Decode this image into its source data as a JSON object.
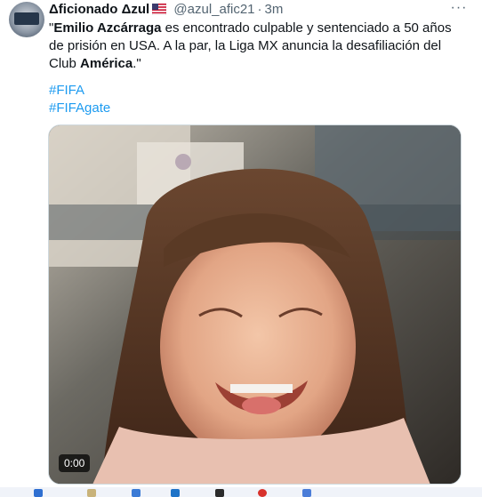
{
  "tweet": {
    "author_name": "Δficionado Δzul",
    "handle": "@azul_afic21",
    "separator": "·",
    "time": "3m",
    "more_label": "···",
    "text": {
      "part1": "\"",
      "bold1": "Emilio Azcárraga",
      "part2": " es encontrado culpable y sentenciado a 50 años de prisión en USA. A la par, la Liga MX anuncia la desafiliación del Club ",
      "bold2": "América",
      "part3": ".\""
    },
    "hashtags": [
      "#FIFA",
      "#FIFAgate"
    ],
    "media": {
      "type": "gif",
      "timestamp": "0:00"
    }
  },
  "colors": {
    "link": "#1d9bf0",
    "secondary_text": "#536471",
    "border": "#cfd9de"
  }
}
